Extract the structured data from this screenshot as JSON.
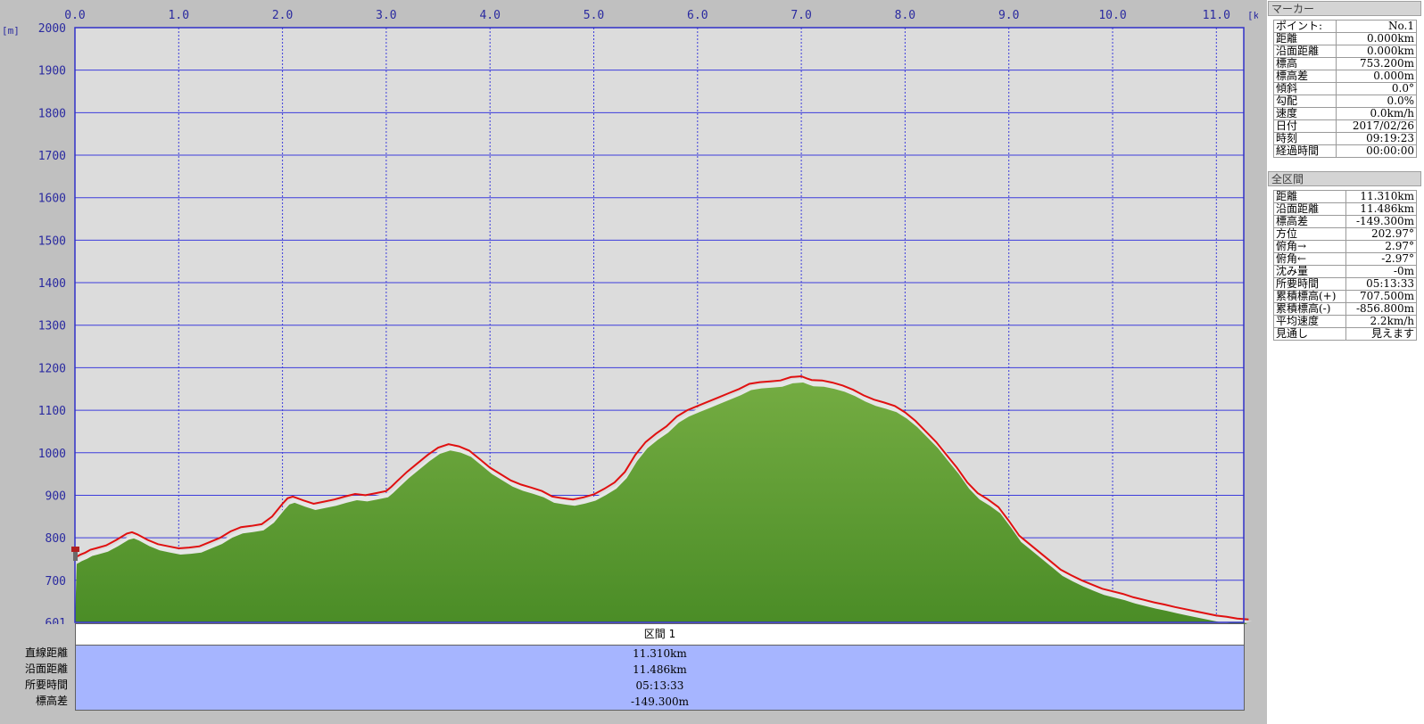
{
  "chart_data": {
    "type": "area",
    "x_unit": "[km]",
    "y_unit": "[m]",
    "xlim": [
      0,
      11.31
    ],
    "ylim": [
      601,
      2000
    ],
    "x_ticks": [
      "0.0",
      "1.0",
      "2.0",
      "3.0",
      "4.0",
      "5.0",
      "6.0",
      "7.0",
      "8.0",
      "9.0",
      "10.0",
      "11.0"
    ],
    "y_ticks": [
      "2000",
      "1900",
      "1800",
      "1700",
      "1600",
      "1500",
      "1400",
      "1300",
      "1200",
      "1100",
      "1000",
      "900",
      "800",
      "700",
      "601"
    ],
    "grid": true,
    "colors": {
      "plot_bg": "#dcdcdc",
      "grid": "#3c3cdc",
      "area_top": "#6ca83c",
      "area_bottom": "#4e9028",
      "line": "#e01010",
      "frame": "#3030c8"
    },
    "series": [
      {
        "x": [
          0,
          0.05,
          0.1,
          0.15,
          0.2,
          0.3,
          0.4,
          0.5,
          0.55,
          0.6,
          0.7,
          0.8,
          0.9,
          1.0,
          1.1,
          1.2,
          1.3,
          1.4,
          1.5,
          1.6,
          1.7,
          1.8,
          1.9,
          2.0,
          2.05,
          2.1,
          2.2,
          2.3,
          2.4,
          2.5,
          2.6,
          2.7,
          2.8,
          2.9,
          3.0,
          3.05,
          3.1,
          3.2,
          3.3,
          3.4,
          3.5,
          3.6,
          3.7,
          3.8,
          3.9,
          4.0,
          4.1,
          4.2,
          4.3,
          4.4,
          4.5,
          4.6,
          4.7,
          4.8,
          4.9,
          5.0,
          5.1,
          5.2,
          5.3,
          5.4,
          5.5,
          5.6,
          5.7,
          5.8,
          5.9,
          6.0,
          6.1,
          6.2,
          6.3,
          6.4,
          6.5,
          6.6,
          6.7,
          6.8,
          6.9,
          7.0,
          7.05,
          7.1,
          7.2,
          7.3,
          7.4,
          7.5,
          7.6,
          7.7,
          7.8,
          7.9,
          8.0,
          8.1,
          8.2,
          8.3,
          8.4,
          8.5,
          8.6,
          8.7,
          8.8,
          8.9,
          9.0,
          9.1,
          9.2,
          9.3,
          9.4,
          9.5,
          9.6,
          9.7,
          9.8,
          9.9,
          10.0,
          10.1,
          10.2,
          10.3,
          10.4,
          10.5,
          10.6,
          10.7,
          10.8,
          10.9,
          11.0,
          11.1,
          11.2,
          11.31
        ],
        "values": [
          753,
          760,
          765,
          772,
          775,
          782,
          795,
          810,
          813,
          808,
          795,
          785,
          780,
          775,
          777,
          780,
          790,
          800,
          815,
          825,
          828,
          832,
          850,
          880,
          893,
          897,
          888,
          880,
          885,
          890,
          897,
          903,
          900,
          905,
          910,
          920,
          932,
          955,
          975,
          995,
          1012,
          1020,
          1015,
          1005,
          985,
          965,
          950,
          935,
          925,
          918,
          910,
          897,
          893,
          890,
          895,
          902,
          915,
          930,
          955,
          995,
          1025,
          1045,
          1062,
          1085,
          1100,
          1110,
          1120,
          1130,
          1140,
          1150,
          1162,
          1166,
          1168,
          1170,
          1178,
          1180,
          1175,
          1171,
          1170,
          1165,
          1158,
          1148,
          1135,
          1125,
          1118,
          1110,
          1095,
          1075,
          1050,
          1025,
          995,
          965,
          930,
          905,
          890,
          872,
          840,
          805,
          785,
          765,
          745,
          725,
          712,
          700,
          690,
          680,
          674,
          668,
          660,
          654,
          648,
          643,
          637,
          632,
          627,
          622,
          617,
          614,
          610,
          608
        ]
      }
    ]
  },
  "marker": {
    "header": "マーカー",
    "rows": [
      {
        "label": "ポイント:",
        "value": "No.1"
      },
      {
        "label": "距離",
        "value": "0.000km"
      },
      {
        "label": "沿面距離",
        "value": "0.000km"
      },
      {
        "label": "標高",
        "value": "753.200m"
      },
      {
        "label": "標高差",
        "value": "0.000m"
      },
      {
        "label": "傾斜",
        "value": "0.0°"
      },
      {
        "label": "勾配",
        "value": "0.0%"
      },
      {
        "label": "速度",
        "value": "0.0km/h"
      },
      {
        "label": "日付",
        "value": "2017/02/26"
      },
      {
        "label": "時刻",
        "value": "09:19:23"
      },
      {
        "label": "経過時間",
        "value": "00:00:00"
      }
    ]
  },
  "total": {
    "header": "全区間",
    "rows": [
      {
        "label": "距離",
        "value": "11.310km"
      },
      {
        "label": "沿面距離",
        "value": "11.486km"
      },
      {
        "label": "標高差",
        "value": "-149.300m"
      },
      {
        "label": "方位",
        "value": "202.97°"
      },
      {
        "label": "俯角→",
        "value": "2.97°"
      },
      {
        "label": "俯角←",
        "value": "-2.97°"
      },
      {
        "label": "沈み量",
        "value": "-0m"
      },
      {
        "label": "所要時間",
        "value": "05:13:33"
      },
      {
        "label": "累積標高(+)",
        "value": "707.500m"
      },
      {
        "label": "累積標高(-)",
        "value": "-856.800m"
      },
      {
        "label": "平均速度",
        "value": "2.2km/h"
      },
      {
        "label": "見通し",
        "value": "見えます"
      }
    ]
  },
  "segment": {
    "title": "区間 1",
    "row_labels": [
      "直線距離",
      "沿面距離",
      "所要時間",
      "標高差"
    ],
    "values": [
      "11.310km",
      "11.486km",
      "05:13:33",
      "-149.300m"
    ]
  }
}
